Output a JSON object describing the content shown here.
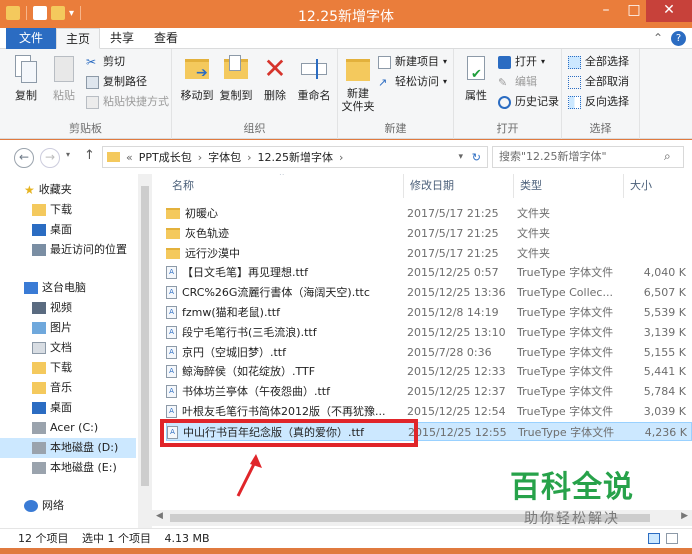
{
  "window": {
    "title": "12.25新增字体",
    "minimize": "–",
    "maximize": "□",
    "close": "✕"
  },
  "tabs": {
    "file": "文件",
    "home": "主页",
    "share": "共享",
    "view": "查看"
  },
  "ribbon": {
    "clipboard": {
      "label": "剪贴板",
      "copy": "复制",
      "paste": "粘贴",
      "cut": "剪切",
      "copy_path": "复制路径",
      "paste_shortcut": "粘贴快捷方式"
    },
    "organize": {
      "label": "组织",
      "move_to": "移动到",
      "copy_to": "复制到",
      "delete": "删除",
      "rename": "重命名"
    },
    "new": {
      "label": "新建",
      "new_folder": "新建\n文件夹",
      "new_item": "新建项目",
      "easy_access": "轻松访问"
    },
    "open": {
      "label": "打开",
      "properties": "属性",
      "open": "打开",
      "edit": "编辑",
      "history": "历史记录"
    },
    "select": {
      "label": "选择",
      "select_all": "全部选择",
      "select_none": "全部取消",
      "invert": "反向选择"
    }
  },
  "address": {
    "back": "←",
    "forward": "→",
    "up": "↑",
    "crumbs": [
      "PPT成长包",
      "字体包",
      "12.25新增字体"
    ],
    "search_placeholder": "搜索\"12.25新增字体\""
  },
  "nav": {
    "favorites": "收藏夹",
    "downloads": "下载",
    "desktop": "桌面",
    "recent": "最近访问的位置",
    "this_pc": "这台电脑",
    "videos": "视频",
    "pictures": "图片",
    "documents": "文档",
    "downloads2": "下载",
    "music": "音乐",
    "desktop2": "桌面",
    "drive_c": "Acer (C:)",
    "drive_d": "本地磁盘 (D:)",
    "drive_e": "本地磁盘 (E:)",
    "network": "网络"
  },
  "columns": {
    "name": "名称",
    "modified": "修改日期",
    "type": "类型",
    "size": "大小"
  },
  "files": [
    {
      "name": "初暖心",
      "date": "2017/5/17 21:25",
      "type": "文件夹",
      "size": "",
      "kind": "folder"
    },
    {
      "name": "灰色轨迹",
      "date": "2017/5/17 21:25",
      "type": "文件夹",
      "size": "",
      "kind": "folder"
    },
    {
      "name": "远行沙漠中",
      "date": "2017/5/17 21:25",
      "type": "文件夹",
      "size": "",
      "kind": "folder"
    },
    {
      "name": "【日文毛笔】再见理想.ttf",
      "date": "2015/12/25 0:57",
      "type": "TrueType 字体文件",
      "size": "4,040 K",
      "kind": "font"
    },
    {
      "name": "CRC%26G流麗行書体（海阔天空).ttc",
      "date": "2015/12/25 13:36",
      "type": "TrueType Collec...",
      "size": "6,507 K",
      "kind": "font"
    },
    {
      "name": "fzmw(猫和老鼠).ttf",
      "date": "2015/12/8 14:19",
      "type": "TrueType 字体文件",
      "size": "5,539 K",
      "kind": "font"
    },
    {
      "name": "段宁毛笔行书(三毛流浪).ttf",
      "date": "2015/12/25 13:10",
      "type": "TrueType 字体文件",
      "size": "3,139 K",
      "kind": "font"
    },
    {
      "name": "京円（空城旧梦）.ttf",
      "date": "2015/7/28 0:36",
      "type": "TrueType 字体文件",
      "size": "5,155 K",
      "kind": "font"
    },
    {
      "name": "鲸海醉侯（如花绽放）.TTF",
      "date": "2015/12/25 12:33",
      "type": "TrueType 字体文件",
      "size": "5,441 K",
      "kind": "font"
    },
    {
      "name": "书体坊兰亭体（午夜怨曲）.ttf",
      "date": "2015/12/25 12:37",
      "type": "TrueType 字体文件",
      "size": "5,784 K",
      "kind": "font"
    },
    {
      "name": "叶根友毛笔行书简体2012版（不再犹豫...",
      "date": "2015/12/25 12:54",
      "type": "TrueType 字体文件",
      "size": "3,039 K",
      "kind": "font"
    },
    {
      "name": "中山行书百年纪念版（真的爱你）.ttf",
      "date": "2015/12/25 12:55",
      "type": "TrueType 字体文件",
      "size": "4,236 K",
      "kind": "font",
      "selected": true
    }
  ],
  "status": {
    "count": "12 个项目",
    "selected": "选中 1 个项目",
    "size": "4.13 MB"
  },
  "watermark": {
    "line1": "百科全说",
    "line2": "助你轻松解决"
  },
  "colors": {
    "title_bar": "#ea7d3b",
    "file_tab": "#2b6cc2",
    "selection": "#cce8ff",
    "highlight_box": "#e0252a",
    "watermark_green": "#27a24a"
  }
}
